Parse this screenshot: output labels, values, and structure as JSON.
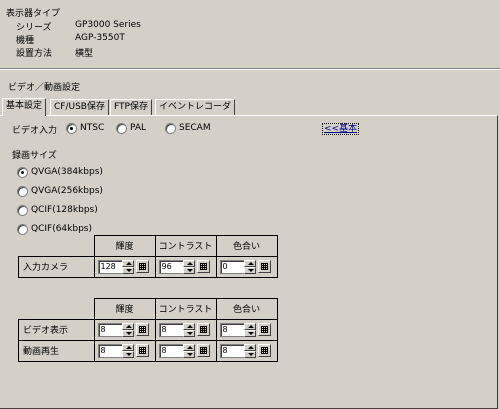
{
  "header": {
    "title": "表示器タイプ",
    "series_label": "シリーズ",
    "series_value": "GP3000 Series",
    "model_label": "機種",
    "model_value": "AGP-3550T",
    "orientation_label": "設置方法",
    "orientation_value": "横型"
  },
  "section_title": "ビデオ／動画設定",
  "tabs": [
    "基本設定",
    "CF/USB保存",
    "FTP保存",
    "イベントレコーダ"
  ],
  "video_input": {
    "label": "ビデオ入力",
    "options": [
      "NTSC",
      "PAL",
      "SECAM"
    ],
    "selected": "NTSC",
    "link": "<<基本"
  },
  "recording_size": {
    "label": "録画サイズ",
    "options": [
      "QVGA(384kbps)",
      "QVGA(256kbps)",
      "QCIF(128kbps)",
      "QCIF(64kbps)"
    ],
    "selected": "QVGA(384kbps)"
  },
  "table1": {
    "headers": [
      "輝度",
      "コントラスト",
      "色合い"
    ],
    "rows": [
      {
        "label": "入力カメラ",
        "values": [
          "128",
          "96",
          "0"
        ]
      }
    ]
  },
  "table2": {
    "headers": [
      "輝度",
      "コントラスト",
      "色合い"
    ],
    "rows": [
      {
        "label": "ビデオ表示",
        "values": [
          "8",
          "8",
          "8"
        ]
      },
      {
        "label": "動画再生",
        "values": [
          "8",
          "8",
          "8"
        ]
      }
    ]
  }
}
